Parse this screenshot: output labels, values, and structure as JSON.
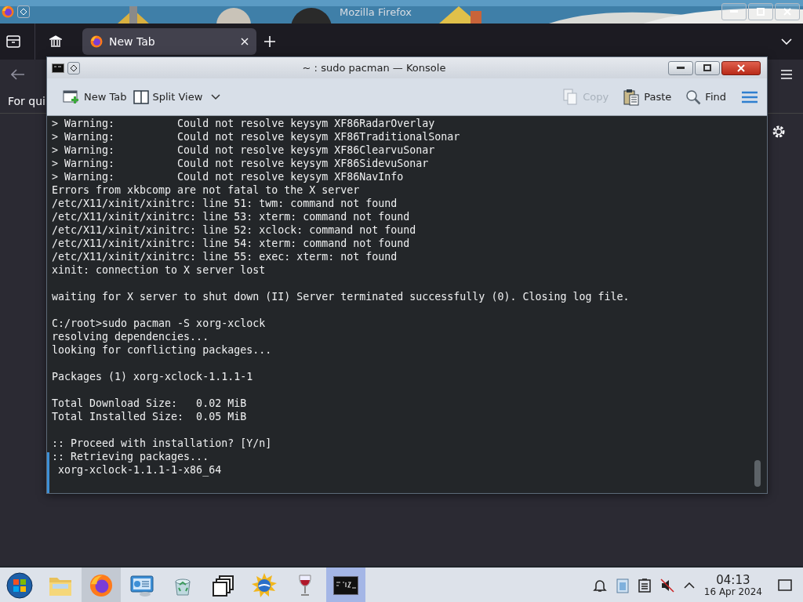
{
  "browser": {
    "title": "Mozilla Firefox",
    "tabs": [
      {
        "label": "New Tab",
        "selected": true
      }
    ],
    "bookmarks_hint": "For qui"
  },
  "konsole": {
    "title": "~ : sudo pacman — Konsole",
    "toolbar_left": [
      {
        "kind": "new-tab",
        "label": "New Tab",
        "disabled": false
      },
      {
        "kind": "split",
        "label": "Split View",
        "disabled": false
      }
    ],
    "toolbar_right": [
      {
        "kind": "copy",
        "label": "Copy",
        "disabled": true
      },
      {
        "kind": "paste",
        "label": "Paste",
        "disabled": false
      },
      {
        "kind": "find",
        "label": "Find",
        "disabled": false
      }
    ],
    "blocks": [
      [
        "> Warning:          Could not resolve keysym XF86RadarOverlay",
        "> Warning:          Could not resolve keysym XF86TraditionalSonar",
        "> Warning:          Could not resolve keysym XF86ClearvuSonar",
        "> Warning:          Could not resolve keysym XF86SidevuSonar",
        "> Warning:          Could not resolve keysym XF86NavInfo",
        "Errors from xkbcomp are not fatal to the X server",
        "/etc/X11/xinit/xinitrc: line 51: twm: command not found",
        "/etc/X11/xinit/xinitrc: line 53: xterm: command not found",
        "/etc/X11/xinit/xinitrc: line 52: xclock: command not found",
        "/etc/X11/xinit/xinitrc: line 54: xterm: command not found",
        "/etc/X11/xinit/xinitrc: line 55: exec: xterm: not found",
        "xinit: connection to X server lost"
      ],
      [
        "waiting for X server to shut down (II) Server terminated successfully (0). Closing log file."
      ],
      [
        "C:/root>sudo pacman -S xorg-xclock",
        "resolving dependencies...",
        "looking for conflicting packages..."
      ],
      [
        "Packages (1) xorg-xclock-1.1.1-1"
      ],
      [
        "Total Download Size:   0.02 MiB",
        "Total Installed Size:  0.05 MiB"
      ],
      [
        ":: Proceed with installation? [Y/n]",
        ":: Retrieving packages...",
        " xorg-xclock-1.1.1-1-x86_64"
      ]
    ]
  },
  "taskbar": {
    "apps": [
      {
        "kind": "start",
        "running": false,
        "selected": false
      },
      {
        "kind": "folder",
        "running": false,
        "selected": false
      },
      {
        "kind": "firefox",
        "running": true,
        "selected": false
      },
      {
        "kind": "control-panel",
        "running": false,
        "selected": false
      },
      {
        "kind": "recycle",
        "running": false,
        "selected": false
      },
      {
        "kind": "windows",
        "running": false,
        "selected": false
      },
      {
        "kind": "globe",
        "running": false,
        "selected": false
      },
      {
        "kind": "wine",
        "running": false,
        "selected": false
      },
      {
        "kind": "terminal",
        "running": true,
        "selected": true
      }
    ],
    "clock": {
      "time": "04:13",
      "date": "16 Apr 2024"
    }
  }
}
